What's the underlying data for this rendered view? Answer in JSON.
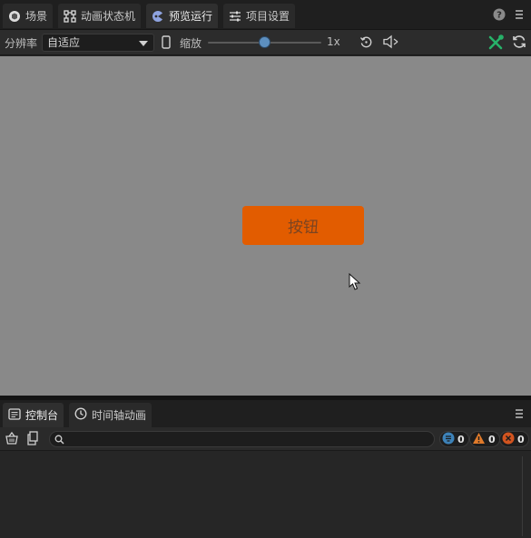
{
  "tabs": [
    {
      "label": "场景",
      "icon": "scene-icon",
      "active": false
    },
    {
      "label": "动画状态机",
      "icon": "state-machine-icon",
      "active": false
    },
    {
      "label": "预览运行",
      "icon": "preview-run-icon",
      "active": true
    },
    {
      "label": "项目设置",
      "icon": "settings-sliders-icon",
      "active": false
    }
  ],
  "toolbar": {
    "resolution_label": "分辨率",
    "resolution_value": "自适应",
    "scale_label": "缩放",
    "zoom_value": "1x",
    "zoom_fraction": 0.5
  },
  "preview": {
    "button_label": "按钮",
    "button_color": "#e25c00",
    "background_color": "#898989"
  },
  "panel_tabs": [
    {
      "label": "控制台",
      "icon": "console-icon",
      "active": true
    },
    {
      "label": "时间轴动画",
      "icon": "timeline-icon",
      "active": false
    }
  ],
  "console": {
    "search_placeholder": "",
    "info_count": "0",
    "warning_count": "0",
    "error_count": "0"
  },
  "colors": {
    "accent": "#5d8fbf",
    "warning": "#e07a2a",
    "error": "#d2541f",
    "info": "#3d82b8",
    "tool_green": "#27b36a"
  }
}
